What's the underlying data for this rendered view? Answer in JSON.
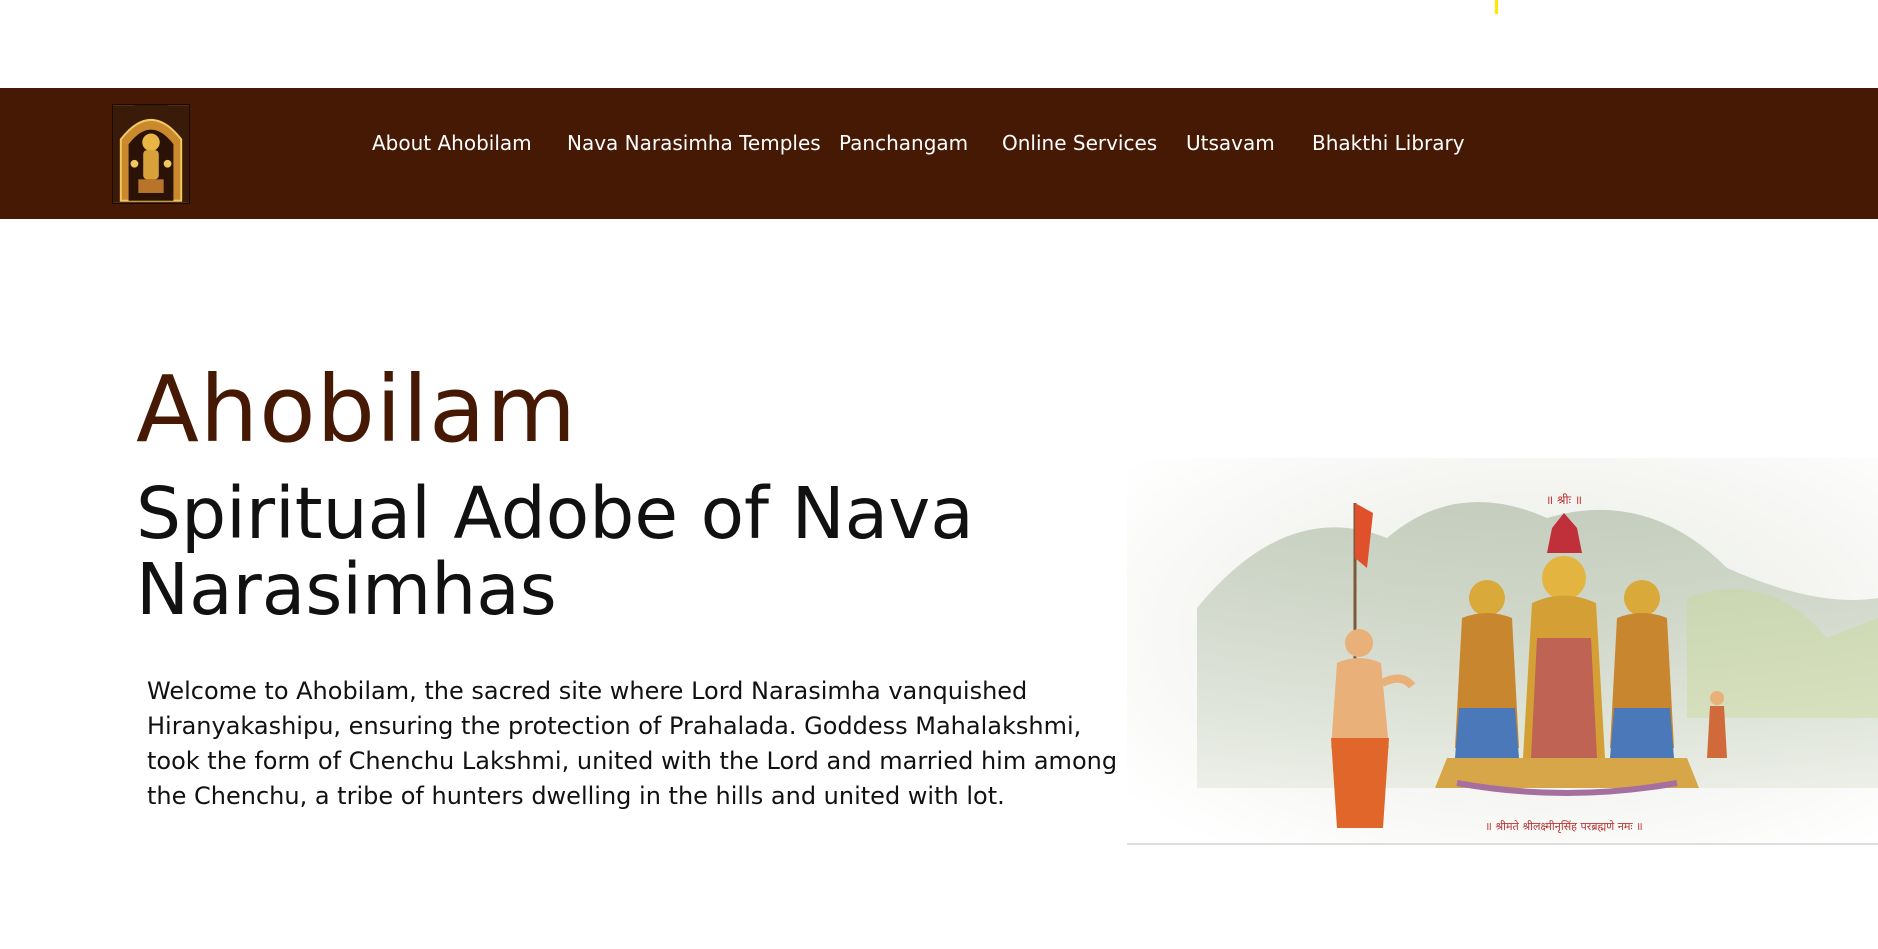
{
  "nav": {
    "logo_alt": "Ahobilam deity logo",
    "items": [
      {
        "label": "About Ahobilam"
      },
      {
        "label": "Nava Narasimha Temples"
      },
      {
        "label": "Panchangam"
      },
      {
        "label": "Online Services"
      },
      {
        "label": "Utsavam"
      },
      {
        "label": "Bhakthi Library"
      }
    ]
  },
  "hero": {
    "title": "Ahobilam",
    "subtitle": "Spiritual Adobe of Nava Narasimhas",
    "description": "Welcome to Ahobilam, the sacred site where Lord Narasimha vanquished Hiranyakashipu, ensuring the protection of Prahalada. Goddess Mahalakshmi, took the form of Chenchu Lakshmi, united with the Lord and married him among the Chenchu, a tribe of hunters dwelling in the hills and united with lot.",
    "image_caption_top": "॥ श्रीः ॥",
    "image_caption_bottom": "॥ श्रीमते श्रीलक्ष्मीनृसिंह परब्रह्मणे नमः ॥"
  },
  "colors": {
    "navbar_bg": "#461904",
    "title": "#461904",
    "accent_yellow": "#ffe800"
  }
}
